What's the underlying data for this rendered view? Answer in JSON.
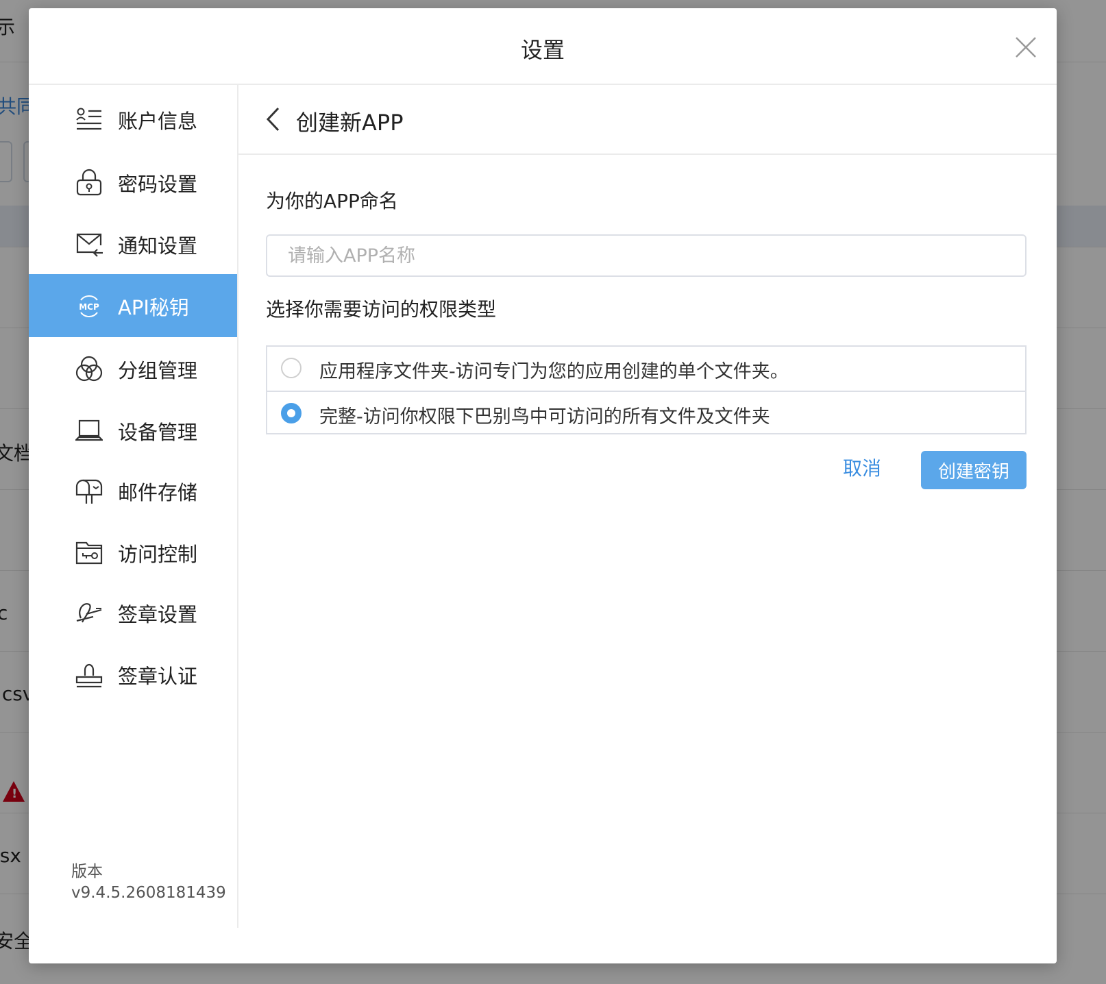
{
  "background": {
    "fragments": [
      "示",
      "共同",
      "文档.",
      "c",
      ".csv",
      "lsx",
      "安全检测更新.xlsx"
    ],
    "warning_icon": "warning-triangle-icon"
  },
  "modal": {
    "title": "设置"
  },
  "sidebar": {
    "items": [
      {
        "label": "账户信息",
        "icon": "account-info-icon",
        "active": false
      },
      {
        "label": "密码设置",
        "icon": "lock-icon",
        "active": false
      },
      {
        "label": "通知设置",
        "icon": "mail-notify-icon",
        "active": false
      },
      {
        "label": "API秘钥",
        "icon": "mcp-icon",
        "active": true
      },
      {
        "label": "分组管理",
        "icon": "group-circles-icon",
        "active": false
      },
      {
        "label": "设备管理",
        "icon": "laptop-icon",
        "active": false
      },
      {
        "label": "邮件存储",
        "icon": "mailbox-icon",
        "active": false
      },
      {
        "label": "访问控制",
        "icon": "folder-key-icon",
        "active": false
      },
      {
        "label": "签章设置",
        "icon": "signature-icon",
        "active": false
      },
      {
        "label": "签章认证",
        "icon": "stamp-icon",
        "active": false
      }
    ],
    "version_label": "版本",
    "version_value": "v9.4.5.2608181439"
  },
  "content": {
    "title": "创建新APP",
    "name_label": "为你的APP命名",
    "name_placeholder": "请输入APP名称",
    "name_value": "",
    "permission_label": "选择你需要访问的权限类型",
    "options": [
      {
        "label": "应用程序文件夹-访问专门为您的应用创建的单个文件夹。",
        "checked": false
      },
      {
        "label": "完整-访问你权限下巴别鸟中可访问的所有文件及文件夹",
        "checked": true
      }
    ],
    "cancel_label": "取消",
    "create_label": "创建密钥"
  },
  "colors": {
    "accent": "#5ba7ea",
    "link": "#3a8de0",
    "radio_checked": "#4a9fe8"
  }
}
